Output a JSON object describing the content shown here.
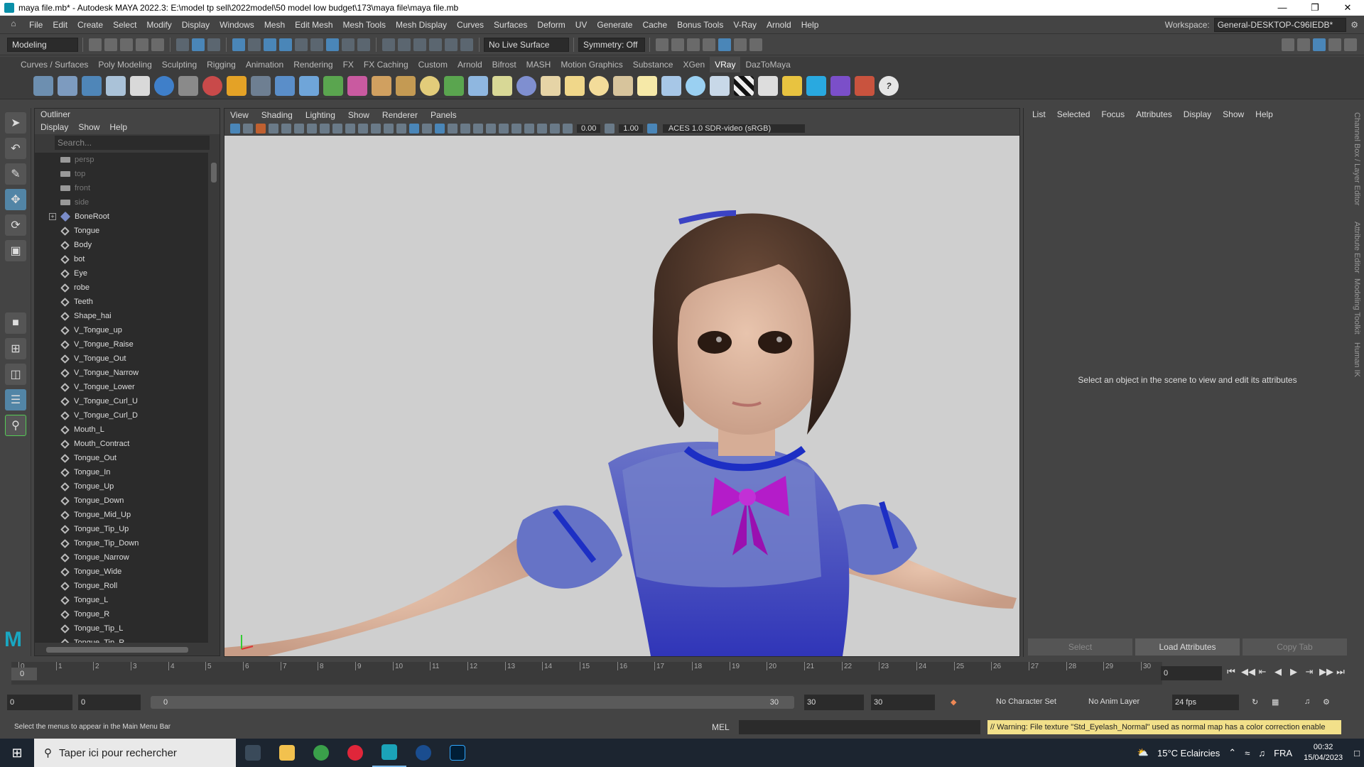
{
  "window": {
    "title": "maya file.mb* - Autodesk MAYA 2022.3: E:\\model tp sell\\2022model\\50 model low budget\\173\\maya file\\maya file.mb"
  },
  "menu": [
    "File",
    "Edit",
    "Create",
    "Select",
    "Modify",
    "Display",
    "Windows",
    "Mesh",
    "Edit Mesh",
    "Mesh Tools",
    "Mesh Display",
    "Curves",
    "Surfaces",
    "Deform",
    "UV",
    "Generate",
    "Cache",
    "Bonus Tools",
    "V-Ray",
    "Arnold",
    "Help"
  ],
  "workspace": {
    "label": "Workspace:",
    "value": "General-DESKTOP-C96IEDB*"
  },
  "statusline": {
    "mode": "Modeling",
    "live_surface": "No Live Surface",
    "symmetry": "Symmetry: Off"
  },
  "shelf_tabs": [
    "Curves / Surfaces",
    "Poly Modeling",
    "Sculpting",
    "Rigging",
    "Animation",
    "Rendering",
    "FX",
    "FX Caching",
    "Custom",
    "Arnold",
    "Bifrost",
    "MASH",
    "Motion Graphics",
    "Substance",
    "XGen",
    "VRay",
    "DazToMaya"
  ],
  "active_shelf_tab": "VRay",
  "outliner": {
    "title": "Outliner",
    "menus": [
      "Display",
      "Show",
      "Help"
    ],
    "search_placeholder": "Search...",
    "items": [
      {
        "name": "persp",
        "type": "camera"
      },
      {
        "name": "top",
        "type": "camera"
      },
      {
        "name": "front",
        "type": "camera"
      },
      {
        "name": "side",
        "type": "camera"
      },
      {
        "name": "BoneRoot",
        "type": "bone"
      },
      {
        "name": "Tongue",
        "type": "mesh"
      },
      {
        "name": "Body",
        "type": "mesh"
      },
      {
        "name": "bot",
        "type": "mesh"
      },
      {
        "name": "Eye",
        "type": "mesh"
      },
      {
        "name": "robe",
        "type": "mesh"
      },
      {
        "name": "Teeth",
        "type": "mesh"
      },
      {
        "name": "Shape_hai",
        "type": "mesh"
      },
      {
        "name": "V_Tongue_up",
        "type": "dim"
      },
      {
        "name": "V_Tongue_Raise",
        "type": "dim"
      },
      {
        "name": "V_Tongue_Out",
        "type": "dim"
      },
      {
        "name": "V_Tongue_Narrow",
        "type": "dim"
      },
      {
        "name": "V_Tongue_Lower",
        "type": "dim"
      },
      {
        "name": "V_Tongue_Curl_U",
        "type": "dim"
      },
      {
        "name": "V_Tongue_Curl_D",
        "type": "dim"
      },
      {
        "name": "Mouth_L",
        "type": "dim"
      },
      {
        "name": "Mouth_Contract",
        "type": "dim"
      },
      {
        "name": "Tongue_Out",
        "type": "dim"
      },
      {
        "name": "Tongue_In",
        "type": "dim"
      },
      {
        "name": "Tongue_Up",
        "type": "dim"
      },
      {
        "name": "Tongue_Down",
        "type": "dim"
      },
      {
        "name": "Tongue_Mid_Up",
        "type": "dim"
      },
      {
        "name": "Tongue_Tip_Up",
        "type": "dim"
      },
      {
        "name": "Tongue_Tip_Down",
        "type": "dim"
      },
      {
        "name": "Tongue_Narrow",
        "type": "dim"
      },
      {
        "name": "Tongue_Wide",
        "type": "dim"
      },
      {
        "name": "Tongue_Roll",
        "type": "dim"
      },
      {
        "name": "Tongue_L",
        "type": "dim"
      },
      {
        "name": "Tongue_R",
        "type": "dim"
      },
      {
        "name": "Tongue_Tip_L",
        "type": "dim"
      },
      {
        "name": "Tongue_Tip_R",
        "type": "dim"
      }
    ]
  },
  "viewport": {
    "menus": [
      "View",
      "Shading",
      "Lighting",
      "Show",
      "Renderer",
      "Panels"
    ],
    "exposure": "0.00",
    "gamma": "1.00",
    "color_mgmt": "ACES 1.0 SDR-video (sRGB)"
  },
  "attribute_editor": {
    "menus": [
      "List",
      "Selected",
      "Focus",
      "Attributes",
      "Display",
      "Show",
      "Help"
    ],
    "message": "Select an object in the scene to view and edit its attributes",
    "buttons": [
      "Select",
      "Load Attributes",
      "Copy Tab"
    ]
  },
  "side_tabs": [
    "Channel Box / Layer Editor",
    "Attribute Editor",
    "Modeling Toolkit",
    "Human IK"
  ],
  "timeline": {
    "ticks": [
      "0",
      "1",
      "2",
      "3",
      "4",
      "5",
      "6",
      "7",
      "8",
      "9",
      "10",
      "11",
      "12",
      "13",
      "14",
      "15",
      "16",
      "17",
      "18",
      "19",
      "20",
      "21",
      "22",
      "23",
      "24",
      "25",
      "26",
      "27",
      "28",
      "29",
      "30"
    ],
    "current": "0",
    "frame_field": "0"
  },
  "range": {
    "start": "0",
    "inner_start": "0",
    "bar_start": "0",
    "bar_end": "30",
    "inner_end": "30",
    "end": "30",
    "character_set": "No Character Set",
    "anim_layer": "No Anim Layer",
    "fps": "24 fps"
  },
  "command": {
    "help": "Select the menus to appear in the Main Menu Bar",
    "lang": "MEL",
    "warning": "// Warning: File texture \"Std_Eyelash_Normal\" used as normal map has a color correction enable"
  },
  "taskbar": {
    "search": "Taper ici pour rechercher",
    "weather": "15°C  Eclaircies",
    "lang": "FRA",
    "time": "00:32",
    "date": "15/04/2023"
  }
}
